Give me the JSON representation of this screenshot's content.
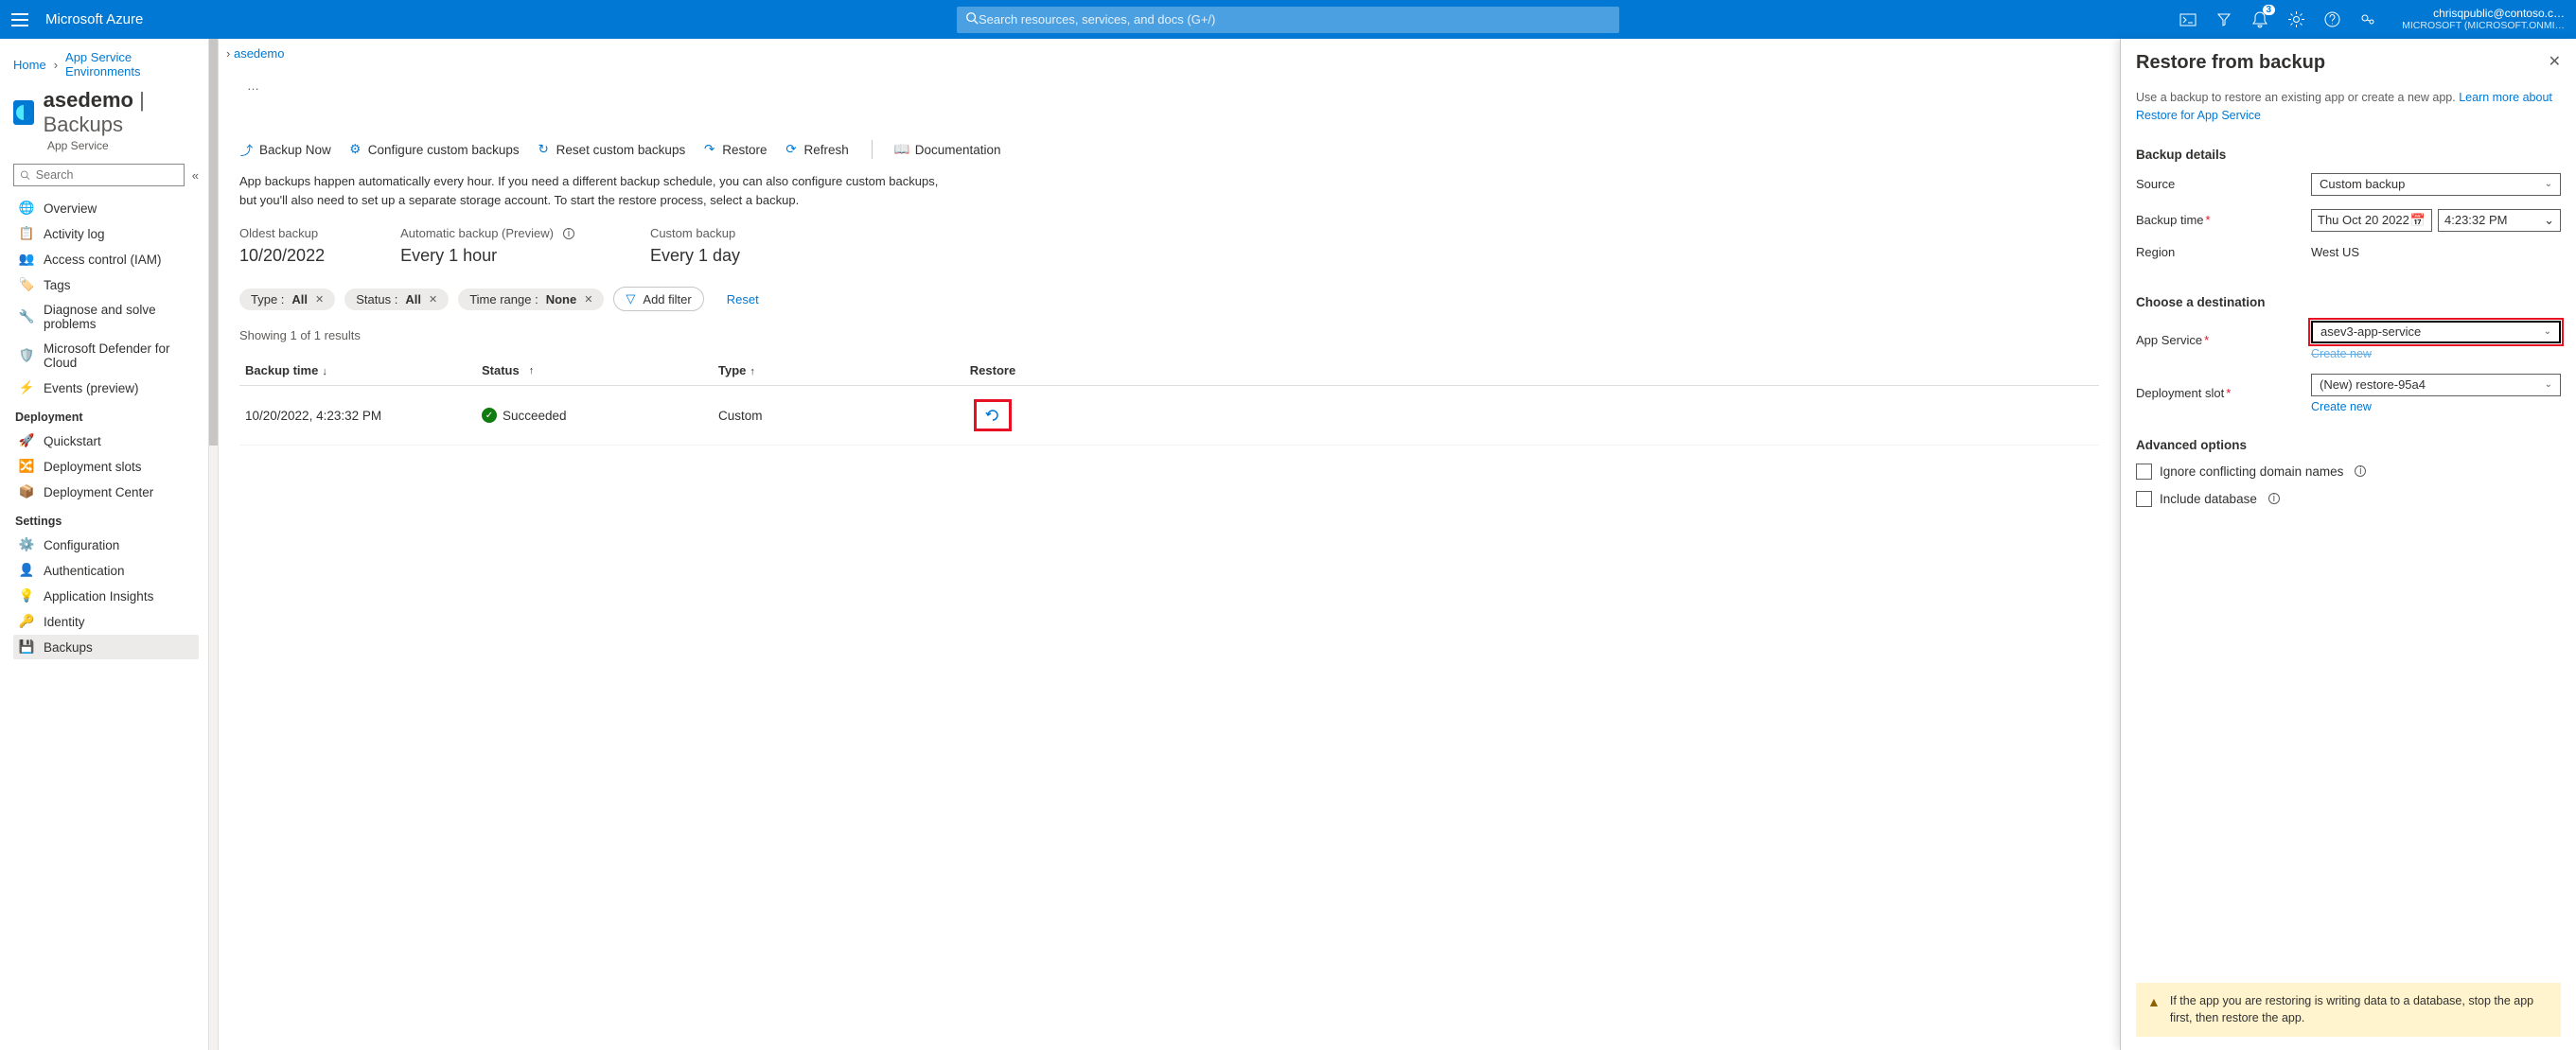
{
  "top": {
    "brand": "Microsoft Azure",
    "search_placeholder": "Search resources, services, and docs (G+/)",
    "notification_count": "3",
    "user_email": "chrisqpublic@contoso.c…",
    "tenant": "MICROSOFT (MICROSOFT.ONMI…"
  },
  "breadcrumbs": [
    "Home",
    "App Service Environments",
    "asedemo"
  ],
  "header": {
    "title_main": "asedemo",
    "title_sub": " | Backups",
    "service": "App Service",
    "ellipsis": "…"
  },
  "sidebar": {
    "search_placeholder": "Search",
    "collapse": "«",
    "items_top": [
      {
        "label": "Overview",
        "icon": "globe"
      },
      {
        "label": "Activity log",
        "icon": "log"
      },
      {
        "label": "Access control (IAM)",
        "icon": "people"
      },
      {
        "label": "Tags",
        "icon": "tag"
      },
      {
        "label": "Diagnose and solve problems",
        "icon": "wrench"
      },
      {
        "label": "Microsoft Defender for Cloud",
        "icon": "shield"
      },
      {
        "label": "Events (preview)",
        "icon": "bolt"
      }
    ],
    "section_deploy": "Deployment",
    "items_deploy": [
      {
        "label": "Quickstart",
        "icon": "rocket"
      },
      {
        "label": "Deployment slots",
        "icon": "slots"
      },
      {
        "label": "Deployment Center",
        "icon": "cube"
      }
    ],
    "section_settings": "Settings",
    "items_settings": [
      {
        "label": "Configuration",
        "icon": "sliders"
      },
      {
        "label": "Authentication",
        "icon": "person"
      },
      {
        "label": "Application Insights",
        "icon": "lamp"
      },
      {
        "label": "Identity",
        "icon": "key"
      },
      {
        "label": "Backups",
        "icon": "backup",
        "active": true
      }
    ]
  },
  "toolbar": {
    "backup_now": "Backup Now",
    "configure": "Configure custom backups",
    "reset": "Reset custom backups",
    "restore": "Restore",
    "refresh": "Refresh",
    "docs": "Documentation"
  },
  "infotext": "App backups happen automatically every hour. If you need a different backup schedule, you can also configure custom backups, but you'll also need to set up a separate storage account. To start the restore process, select a backup.",
  "stats": {
    "oldest_label": "Oldest backup",
    "oldest_value": "10/20/2022",
    "auto_label": "Automatic backup (Preview)",
    "auto_value": "Every 1 hour",
    "custom_label": "Custom backup",
    "custom_value": "Every 1 day"
  },
  "filters": {
    "type_label": "Type : ",
    "type_value": "All",
    "status_label": "Status : ",
    "status_value": "All",
    "timerange_label": "Time range : ",
    "timerange_value": "None",
    "addfilter": "Add filter",
    "reset": "Reset"
  },
  "showing": "Showing 1 of 1 results",
  "table": {
    "cols": {
      "time": "Backup time",
      "status": "Status",
      "type": "Type",
      "restore": "Restore"
    },
    "rows": [
      {
        "time": "10/20/2022, 4:23:32 PM",
        "status": "Succeeded",
        "type": "Custom"
      }
    ]
  },
  "panel": {
    "title": "Restore from backup",
    "desc": "Use a backup to restore an existing app or create a new app. ",
    "learn_link": "Learn more about Restore for App Service",
    "section_backup": "Backup details",
    "source_label": "Source",
    "source_value": "Custom backup",
    "backuptime_label": "Backup time",
    "date_value": "Thu Oct 20 2022",
    "time_value": "4:23:32 PM",
    "region_label": "Region",
    "region_value": "West US",
    "section_dest": "Choose a destination",
    "appsvc_label": "App Service",
    "appsvc_value": "asev3-app-service",
    "create_new": "Create new",
    "slot_label": "Deployment slot",
    "slot_value": "(New) restore-95a4",
    "section_adv": "Advanced options",
    "ignore_label": "Ignore conflicting domain names",
    "include_label": "Include database",
    "warning": "If the app you are restoring is writing data to a database, stop the app first, then restore the app."
  }
}
